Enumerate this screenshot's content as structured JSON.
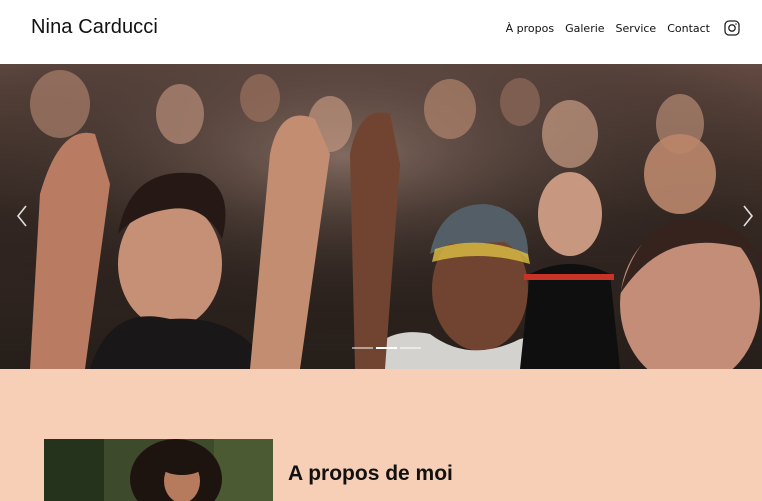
{
  "header": {
    "brand": "Nina Carducci",
    "nav": [
      "À propos",
      "Galerie",
      "Service",
      "Contact"
    ],
    "social_icon": "instagram-icon"
  },
  "carousel": {
    "image": "concert crowd cheering",
    "slide_count": 3,
    "active_slide": 2,
    "prev_icon": "chevron-left-icon",
    "next_icon": "chevron-right-icon"
  },
  "about": {
    "title": "A propos de moi",
    "background_color": "#f6cfb6",
    "portrait": "portrait of woman with curly hair"
  }
}
